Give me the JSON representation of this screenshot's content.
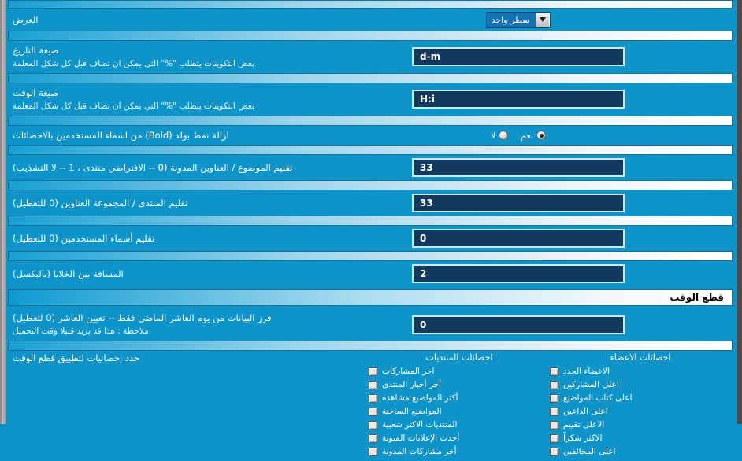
{
  "theme": {
    "page_bg": "#0e94c9",
    "input_bg": "#123a5e",
    "input_border": "#c9e9f7",
    "header_text": "#0a0a0a"
  },
  "rows": {
    "display": {
      "label": "العرض",
      "select_value": "سطر واحد",
      "arrow_icon": "chevron-down-icon"
    },
    "date_format": {
      "label": "صيغة التاريخ",
      "desc": "بعض التكوينات يتطلب  \"%\"  التي يمكن ان تضاف قبل كل شكل المعلمة",
      "value": "d-m"
    },
    "time_format": {
      "label": "صيغة الوقت",
      "desc": "بعض التكوينات يتطلب  \"%\"  التي يمكن ان تضاف قبل كل شكل المعلمة",
      "value": "H:i"
    },
    "remove_bold": {
      "label": "ازالة نمط بولد (Bold) من اسماء المستخدمين بالاحصائات",
      "options": [
        {
          "label": "نعم",
          "checked": true
        },
        {
          "label": "لا",
          "checked": false
        }
      ]
    },
    "trim_topic": {
      "label": "تقليم الموضوع / العناوين المدونة (0 -- الافتراضي منتدى ، 1 -- لا التشذيب)",
      "value": "33"
    },
    "trim_forum": {
      "label": "تقليم المنتدى / المجموعة العناوين (0 للتعطيل)",
      "value": "33"
    },
    "trim_usernames": {
      "label": "تقليم أسماء المستخدمين (0 للتعطيل)",
      "value": "0"
    },
    "cell_spacing": {
      "label": "المسافة بين الخلايا (بالبكسل)",
      "value": "2"
    }
  },
  "timecut_section": {
    "title": "قطع الوقت",
    "sort_rows": {
      "label": "فرز البيانات من يوم العاشر الماضي فقط -- تعيين العاشر  (0 لتعطيل)",
      "desc": "ملاحظة : هذا قد يزيد قليلا وقت التحميل",
      "value": "0"
    },
    "select_label": "حدد إحصائيات لتطبيق قطع الوقت",
    "columns": [
      {
        "title": "احصائات المنتديات",
        "items": [
          {
            "label": "اخر المشاركات",
            "checked": false
          },
          {
            "label": "آخر أخبار المنتدى",
            "checked": false
          },
          {
            "label": "أكثر المواضيع مشاهدة",
            "checked": false
          },
          {
            "label": "المواضيع الساخنة",
            "checked": false
          },
          {
            "label": "المنتديات الاكثر شعبية",
            "checked": false
          },
          {
            "label": "أحدث الإعلانات المبوبة",
            "checked": false
          },
          {
            "label": "أخر مشاركات المدونة",
            "checked": false
          }
        ]
      },
      {
        "title": "احصائات الاعضاء",
        "items": [
          {
            "label": "الاعضاء الجدد",
            "checked": false
          },
          {
            "label": "اعلى المشاركين",
            "checked": false
          },
          {
            "label": "اعلى كتاب المواضيع",
            "checked": false
          },
          {
            "label": "اعلى الداعين",
            "checked": false
          },
          {
            "label": "الاعلى تقييم",
            "checked": false
          },
          {
            "label": "الاكثر شكراً",
            "checked": false
          },
          {
            "label": "اعلى المخالفين",
            "checked": false
          }
        ]
      }
    ]
  }
}
